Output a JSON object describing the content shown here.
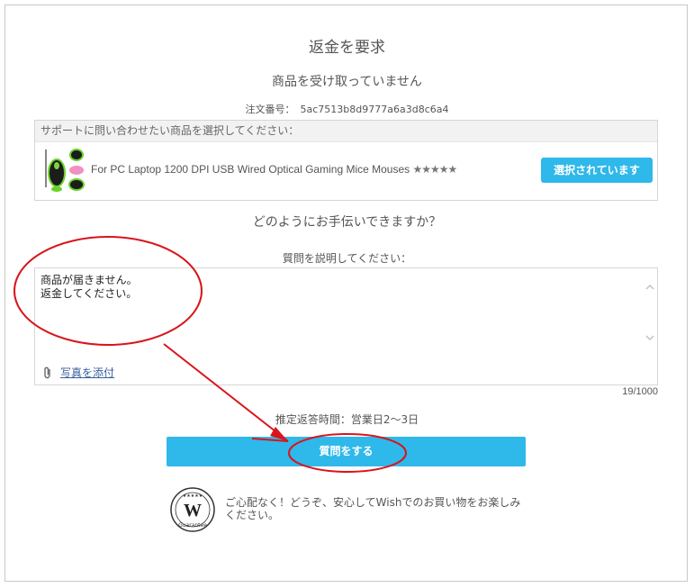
{
  "page": {
    "title": "返金を要求",
    "subtitle": "商品を受け取っていません",
    "order_label": "注文番号：",
    "order_number": "5ac7513b8d9777a6a3d8c6a4"
  },
  "product_section": {
    "heading": "サポートに問い合わせたい商品を選択してください：",
    "product_name": "For PC Laptop 1200 DPI USB Wired Optical Gaming Mice Mouses",
    "stars": "★★★★★",
    "selected_label": "選択されています"
  },
  "help": {
    "question": "どのようにお手伝いできますか？",
    "describe_label": "質問を説明してください："
  },
  "textarea": {
    "value": "商品が届きません。\n返金してください。",
    "attach_label": "写真を添付",
    "counter": "19/1000"
  },
  "eta": "推定返答時間：営業日2〜3日",
  "submit_label": "質問をする",
  "guarantee": {
    "badge_text": "Guarantee",
    "badge_letter": "W",
    "message": "ご心配なく！どうぞ、安心してWishでのお買い物をお楽しみください。"
  },
  "colors": {
    "accent": "#2fb8ea",
    "annotation": "#d9141b",
    "link": "#3a5f9c"
  }
}
